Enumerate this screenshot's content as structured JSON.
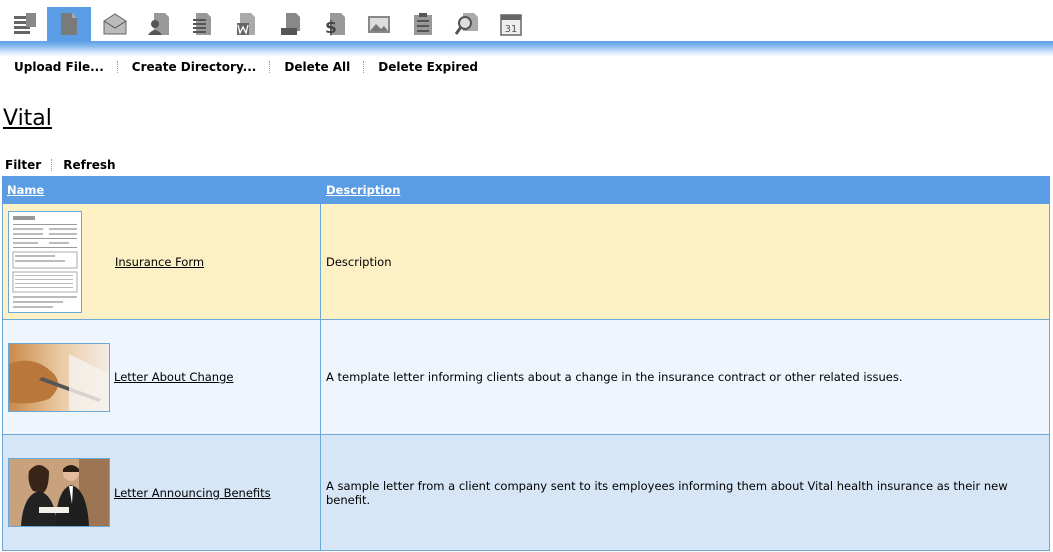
{
  "toolbar_icons": [
    {
      "name": "stack-icon",
      "active": false
    },
    {
      "name": "document-icon",
      "active": true
    },
    {
      "name": "envelope-icon",
      "active": false
    },
    {
      "name": "contact-icon",
      "active": false
    },
    {
      "name": "text-document-icon",
      "active": false
    },
    {
      "name": "word-document-icon",
      "active": false
    },
    {
      "name": "print-document-icon",
      "active": false
    },
    {
      "name": "dollar-document-icon",
      "active": false
    },
    {
      "name": "image-icon",
      "active": false
    },
    {
      "name": "clipboard-checklist-icon",
      "active": false
    },
    {
      "name": "search-document-icon",
      "active": false
    },
    {
      "name": "calendar-icon",
      "active": false,
      "label": "31"
    }
  ],
  "actions": {
    "upload": "Upload File...",
    "create_dir": "Create Directory...",
    "delete_all": "Delete All",
    "delete_expired": "Delete Expired"
  },
  "page_title": "Vital",
  "filterbar": {
    "filter": "Filter",
    "refresh": "Refresh"
  },
  "table": {
    "headers": {
      "name": "Name",
      "description": "Description"
    },
    "rows": [
      {
        "name": "Insurance Form",
        "description": "Description",
        "thumb": "form"
      },
      {
        "name": "Letter About Change",
        "description": "A template letter informing clients about a change in the insurance contract or other related issues.",
        "thumb": "hand"
      },
      {
        "name": "Letter Announcing Benefits",
        "description": "A sample letter from a client company sent to its employees informing them about Vital health insurance as their new benefit.",
        "thumb": "people"
      }
    ]
  },
  "colors": {
    "accent": "#5b9de4",
    "row_highlight": "#fdf0c4",
    "row_alt": "#eef5fd",
    "row_alt2": "#d6e6f6"
  }
}
